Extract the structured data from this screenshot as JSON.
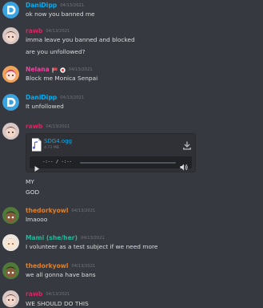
{
  "colors": {
    "background": "#36393f",
    "text": "#dcddde",
    "timestamp": "#72767d",
    "name_danidipp": "#00aff4",
    "name_rawb": "#e91e63",
    "name_nelana": "#eb459e",
    "name_thedorkyowl": "#e67e22",
    "name_mami": "#1abc9c",
    "link": "#00aff4"
  },
  "messages": [
    {
      "author": "DaniDipp",
      "timestamp": "04/13/2021",
      "lines": [
        "ok now you banned me"
      ],
      "avatar_icon": "discord-logo-icon"
    },
    {
      "author": "rawb",
      "timestamp": "04/13/2021",
      "lines": [
        "imma leave you banned and blocked",
        "are you unfollowed?"
      ],
      "avatar_icon": "anime-avatar-icon"
    },
    {
      "author": "Nelana",
      "timestamp": "04/13/2021",
      "lines": [
        "Block me Monica Senpai"
      ],
      "avatar_icon": "anime-avatar-icon",
      "badges": [
        "flag-icon",
        "clock-badge-icon"
      ]
    },
    {
      "author": "DaniDipp",
      "timestamp": "04/13/2021",
      "lines": [
        "It unfollowed"
      ],
      "avatar_icon": "discord-logo-icon"
    },
    {
      "author": "rawb",
      "timestamp": "04/13/2021",
      "lines": [
        "MY",
        "GOD"
      ],
      "avatar_icon": "anime-avatar-icon",
      "attachment": {
        "file_name": "SDG4.ogg",
        "file_size": "4.73 MB",
        "time_display": "-:-- / -:--",
        "progress": 0.0
      }
    },
    {
      "author": "thedorkyowl",
      "timestamp": "04/13/2021",
      "lines": [
        "lmaooo"
      ],
      "avatar_icon": "owl-avatar-icon"
    },
    {
      "author": "Mami (she/her)",
      "timestamp": "04/13/2021",
      "lines": [
        "I volunteer as a test subject if we need more"
      ],
      "avatar_icon": "anime-avatar-icon"
    },
    {
      "author": "thedorkyowl",
      "timestamp": "04/13/2021",
      "lines": [
        "we all gonna have bans"
      ],
      "avatar_icon": "owl-avatar-icon"
    },
    {
      "author": "rawb",
      "timestamp": "04/13/2021",
      "lines": [
        "WE SHOULD DO THIS"
      ],
      "avatar_icon": "anime-avatar-icon"
    }
  ]
}
